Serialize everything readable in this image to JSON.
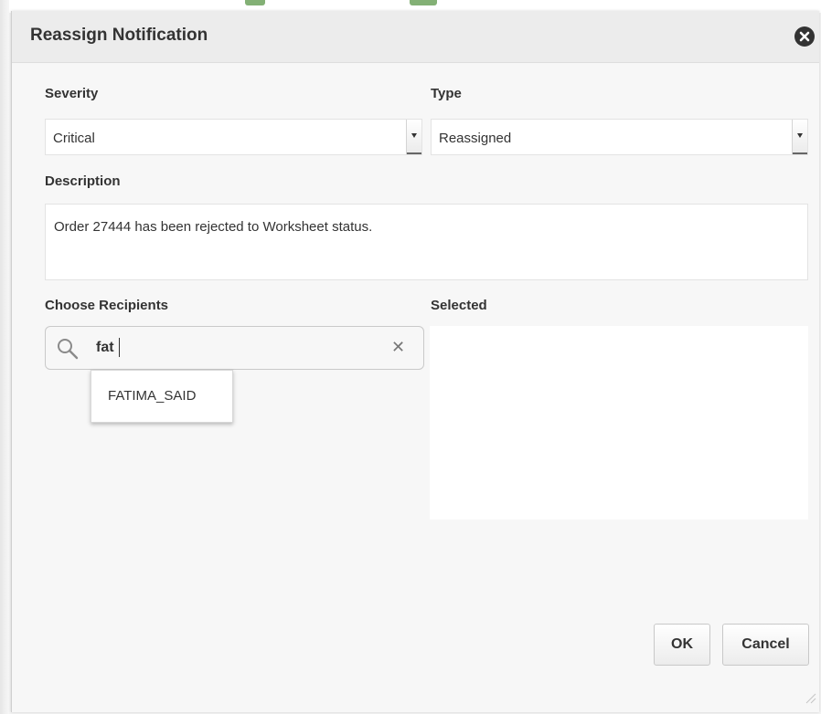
{
  "dialog": {
    "title": "Reassign Notification",
    "close_icon": "close-circle-icon"
  },
  "form": {
    "severity": {
      "label": "Severity",
      "value": "Critical"
    },
    "type": {
      "label": "Type",
      "value": "Reassigned"
    },
    "description": {
      "label": "Description",
      "value": "Order 27444 has been rejected to Worksheet status."
    },
    "recipients": {
      "label": "Choose Recipients",
      "search_value": "fat",
      "search_icon": "search-icon",
      "clear_icon": "clear-icon",
      "suggestions": [
        "FATIMA_SAID"
      ]
    },
    "selected": {
      "label": "Selected",
      "items": []
    }
  },
  "footer": {
    "ok_label": "OK",
    "cancel_label": "Cancel"
  },
  "colors": {
    "dialog_bg": "#f7f7f7",
    "header_bg": "#ececec",
    "field_bg": "#ffffff",
    "text": "#333333"
  }
}
